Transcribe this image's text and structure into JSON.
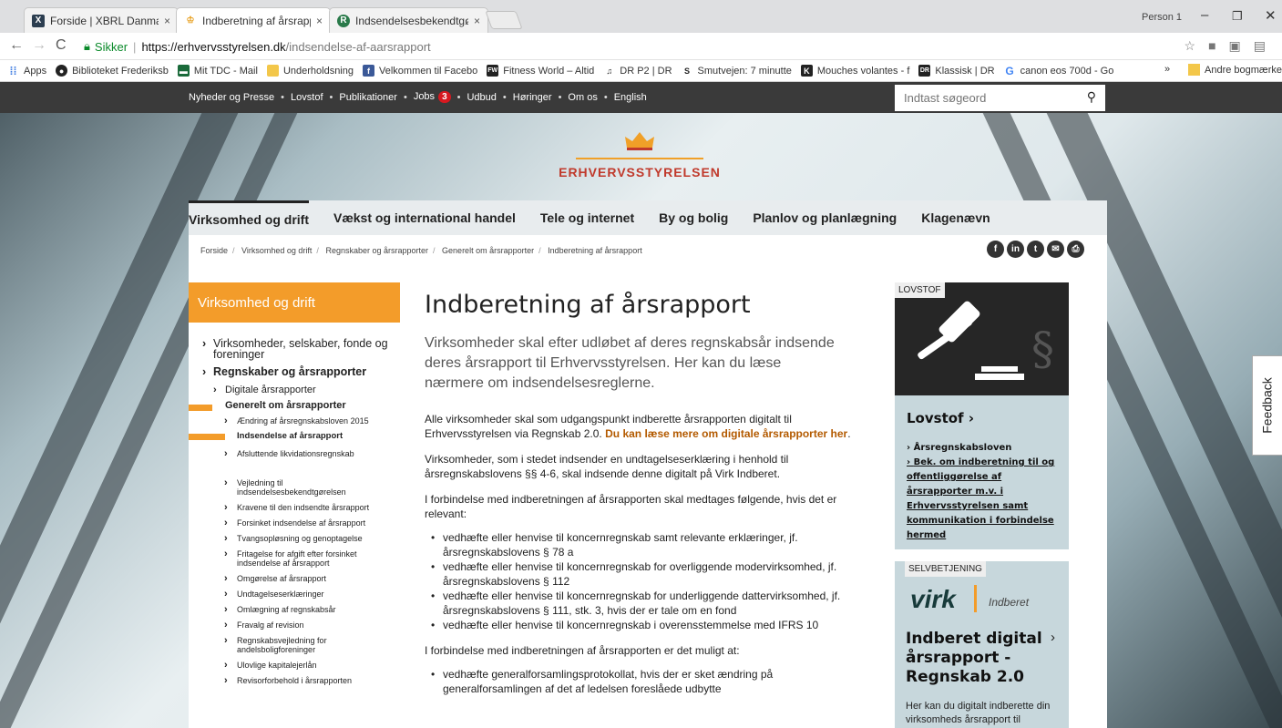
{
  "browser": {
    "tabs": [
      {
        "title": "Forside | XBRL Danmark"
      },
      {
        "title": "Indberetning af årsrappo"
      },
      {
        "title": "Indsendelsesbekendtgør"
      }
    ],
    "profile": "Person 1",
    "url_secure": "Sikker",
    "url_host": "https://erhvervsstyrelsen.dk",
    "url_path": "/indsendelse-af-aarsrapport",
    "bookmarks": [
      "Apps",
      "Biblioteket Frederiksb",
      "Mit TDC - Mail",
      "Underholdsning",
      "Velkommen til Facebo",
      "Fitness World – Altid",
      "DR P2 | DR",
      "Smutvejen: 7 minutte",
      "Mouches volantes - f",
      "Klassisk | DR",
      "canon eos 700d - Go"
    ],
    "bookmarks_more": "»",
    "bookmarks_other": "Andre bogmærke"
  },
  "topnav": {
    "items": [
      "Nyheder og Presse",
      "Lovstof",
      "Publikationer",
      "Jobs",
      "Udbud",
      "Høringer",
      "Om os",
      "English"
    ],
    "jobs_badge": "3",
    "search_placeholder": "Indtast søgeord"
  },
  "logo": {
    "name": "Erhvervsstyrelsen"
  },
  "mainnav": [
    "Virksomhed og drift",
    "Vækst og international handel",
    "Tele og internet",
    "By og bolig",
    "Planlov og planlægning",
    "Klagenævn"
  ],
  "breadcrumb": [
    "Forside",
    "Virksomhed og drift",
    "Regnskaber og årsrapporter",
    "Generelt om årsrapporter",
    "Indberetning af årsrapport"
  ],
  "leftnav": {
    "heading": "Virksomhed og drift",
    "items": [
      "Virksomheder, selskaber, fonde og foreninger",
      "Regnskaber og årsrapporter",
      "Digitale årsrapporter",
      "Generelt om årsrapporter",
      "Ændring af årsregnskabsloven 2015",
      "Indsendelse af årsrapport",
      "Afsluttende likvidationsregnskab",
      "Vejledning til indsendelsesbekendtgørelsen",
      "Kravene til den indsendte årsrapport",
      "Forsinket indsendelse af årsrapport",
      "Tvangsopløsning og genoptagelse",
      "Fritagelse for afgift efter forsinket indsendelse af årsrapport",
      "Omgørelse af årsrapport",
      "Undtagelseserklæringer",
      "Omlægning af regnskabsår",
      "Fravalg af revision",
      "Regnskabsvejledning for andelsboligforeninger",
      "Ulovlige kapitalejerlån",
      "Revisorforbehold i årsrapporten"
    ]
  },
  "article": {
    "title": "Indberetning af årsrapport",
    "lead": "Virksomheder skal efter udløbet af deres regnskabsår indsende deres årsrapport til Erhvervsstyrelsen. Her kan du læse nærmere om indsendelsesreglerne.",
    "p1": "Alle virksomheder skal som udgangspunkt indberette årsrapporten digitalt til Erhvervsstyrelsen via Regnskab 2.0.",
    "p1_link": "Du kan læse mere om digitale årsrapporter her",
    "p1_end": ".",
    "p2": "Virksomheder, som i stedet indsender en undtagelseserklæring i henhold til årsregnskabslovens §§ 4-6, skal indsende denne digitalt på Virk Indberet.",
    "p3": "I forbindelse med indberetningen af årsrapporten skal medtages følgende, hvis det er relevant:",
    "list1": [
      "vedhæfte eller henvise til koncernregnskab samt relevante erklæringer, jf. årsregnskabslovens § 78 a",
      "vedhæfte eller henvise til koncernregnskab for overliggende modervirksomhed, jf. årsregnskabslovens § 112",
      "vedhæfte eller henvise til koncernregnskab for underliggende dattervirksomhed, jf. årsregnskabslovens § 111, stk. 3, hvis der er tale om en fond",
      "vedhæfte eller henvise til koncernregnskab i overensstemmelse med IFRS 10"
    ],
    "p4": "I forbindelse med indberetningen af årsrapporten er det muligt at:",
    "list2": [
      "vedhæfte generalforsamlingsprotokollat, hvis der er sket ændring på generalforsamlingen af det af ledelsen foreslåede udbytte"
    ]
  },
  "right": {
    "box1_tag": "LOVSTOF",
    "box1_title": "Lovstof",
    "box1_links": [
      "Årsregnskabsloven",
      "Bek. om indberetning til og offentliggørelse af årsrapporter m.v. i Erhvervsstyrelsen samt kommunikation i forbindelse hermed"
    ],
    "box2_tag": "SELVBETJENING",
    "box2_logo": "virk",
    "box2_logo_sub": "Indberet",
    "box2_title": "Indberet digital årsrapport - Regnskab 2.0",
    "box2_desc": "Her kan du digitalt indberette din virksomheds årsrapport til"
  },
  "feedback": "Feedback"
}
